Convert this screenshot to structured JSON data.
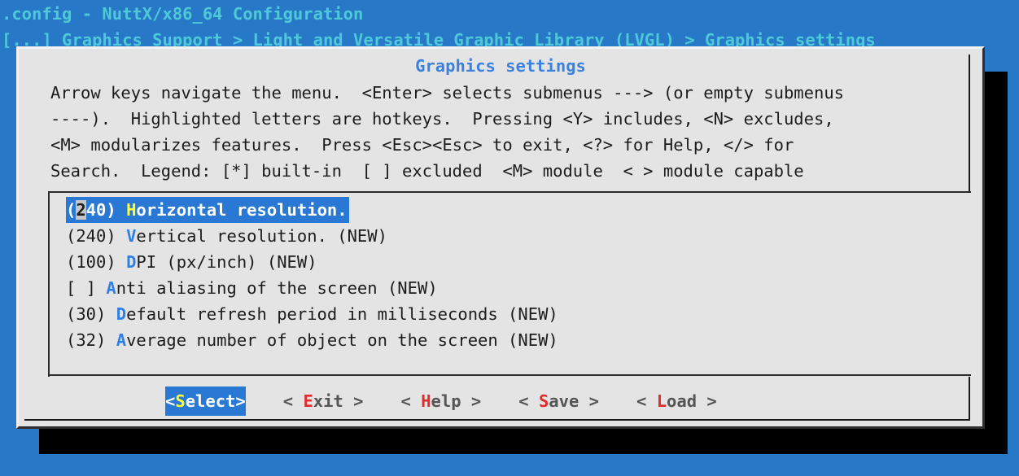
{
  "header": {
    "title": ".config - NuttX/x86_64 Configuration",
    "breadcrumb": "[...] Graphics Support > Light and Versatile Graphic Library (LVGL) > Graphics settings"
  },
  "dialog": {
    "title": "Graphics settings",
    "help_lines": [
      "Arrow keys navigate the menu.  <Enter> selects submenus ---> (or empty submenus",
      "----).  Highlighted letters are hotkeys.  Pressing <Y> includes, <N> excludes,",
      "<M> modularizes features.  Press <Esc><Esc> to exit, <?> for Help, </> for",
      "Search.  Legend: [*] built-in  [ ] excluded  <M> module  < > module capable"
    ]
  },
  "menu": {
    "items": [
      {
        "prefix_open": "(",
        "cursor_char": "2",
        "prefix_rest": "40) ",
        "hotkey": "H",
        "label": "orizontal resolution.",
        "suffix": "",
        "selected": true
      },
      {
        "prefix": "(240) ",
        "hotkey": "V",
        "label": "ertical resolution. (NEW)",
        "selected": false
      },
      {
        "prefix": "(100) ",
        "hotkey": "D",
        "label": "PI (px/inch) (NEW)",
        "selected": false
      },
      {
        "prefix": "[ ] ",
        "hotkey": "A",
        "label": "nti aliasing of the screen (NEW)",
        "selected": false
      },
      {
        "prefix": "(30) ",
        "hotkey": "D",
        "label": "efault refresh period in milliseconds (NEW)",
        "selected": false
      },
      {
        "prefix": "(32) ",
        "hotkey": "A",
        "label": "verage number of object on the screen (NEW)",
        "selected": false
      }
    ]
  },
  "buttons": [
    {
      "open": "<",
      "hotkey": "S",
      "label": "elect",
      "close": ">",
      "active": true,
      "name": "select"
    },
    {
      "open": "< ",
      "hotkey": "E",
      "label": "xit",
      "close": " >",
      "active": false,
      "name": "exit"
    },
    {
      "open": "< ",
      "hotkey": "H",
      "label": "elp",
      "close": " >",
      "active": false,
      "name": "help"
    },
    {
      "open": "< ",
      "hotkey": "S",
      "label": "ave",
      "close": " >",
      "active": false,
      "name": "save"
    },
    {
      "open": "< ",
      "hotkey": "L",
      "label": "oad",
      "close": " >",
      "active": false,
      "name": "load"
    }
  ],
  "colors": {
    "background": "#2878c8",
    "header_text": "#4ec9d8",
    "dialog_bg": "#e4e4e4",
    "dialog_title": "#3b82e0",
    "selection_bg": "#2878d4",
    "hotkey_blue": "#2e7fe8",
    "hotkey_yellow": "#ffff33",
    "hotkey_red": "#e02b2b",
    "cursor_bg": "#c6c6c6"
  }
}
